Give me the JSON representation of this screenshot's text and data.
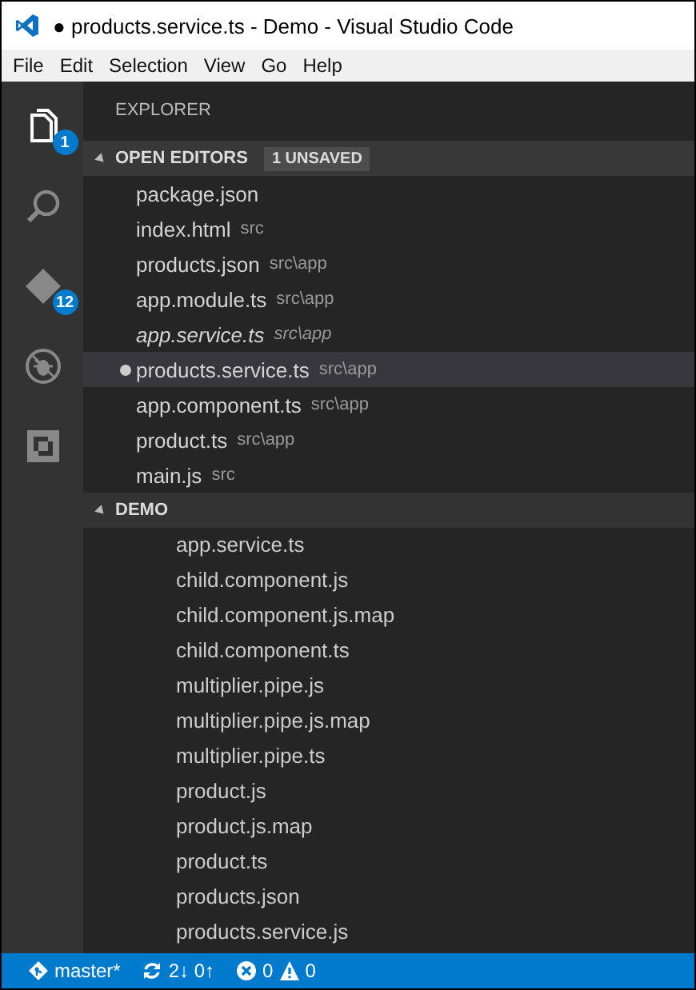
{
  "window": {
    "title": "● products.service.ts - Demo - Visual Studio Code"
  },
  "menu": [
    "File",
    "Edit",
    "Selection",
    "View",
    "Go",
    "Help"
  ],
  "activity_bar": [
    {
      "kind": "files",
      "selected": true,
      "badge": "1"
    },
    {
      "kind": "search",
      "selected": false
    },
    {
      "kind": "git",
      "selected": false,
      "badge": "12"
    },
    {
      "kind": "debug",
      "selected": false
    },
    {
      "kind": "extensions",
      "selected": false
    }
  ],
  "sidebar": {
    "title": "EXPLORER",
    "open_editors": {
      "title": "OPEN EDITORS",
      "badge": "1 UNSAVED",
      "expanded": true,
      "items": [
        {
          "name": "package.json",
          "selected": false,
          "dirty": false,
          "preview": false
        },
        {
          "name": "index.html",
          "path": "src",
          "selected": false,
          "dirty": false,
          "preview": false
        },
        {
          "name": "products.json",
          "path": "src\\app",
          "selected": false,
          "dirty": false,
          "preview": false
        },
        {
          "name": "app.module.ts",
          "path": "src\\app",
          "selected": false,
          "dirty": false,
          "preview": false
        },
        {
          "name": "app.service.ts",
          "path": "src\\app",
          "selected": false,
          "dirty": false,
          "preview": true
        },
        {
          "name": "products.service.ts",
          "path": "src\\app",
          "selected": true,
          "dirty": true,
          "preview": false
        },
        {
          "name": "app.component.ts",
          "path": "src\\app",
          "selected": false,
          "dirty": false,
          "preview": false
        },
        {
          "name": "product.ts",
          "path": "src\\app",
          "selected": false,
          "dirty": false,
          "preview": false
        },
        {
          "name": "main.js",
          "path": "src",
          "selected": false,
          "dirty": false,
          "preview": false
        }
      ]
    },
    "demo": {
      "title": "DEMO",
      "expanded": true,
      "files": [
        "app.service.ts",
        "child.component.js",
        "child.component.js.map",
        "child.component.ts",
        "multiplier.pipe.js",
        "multiplier.pipe.js.map",
        "multiplier.pipe.ts",
        "product.js",
        "product.js.map",
        "product.ts",
        "products.json",
        "products.service.js"
      ]
    }
  },
  "status_bar": {
    "branch": "master*",
    "sync": "2↓ 0↑",
    "errors": "0",
    "warnings": "0"
  }
}
